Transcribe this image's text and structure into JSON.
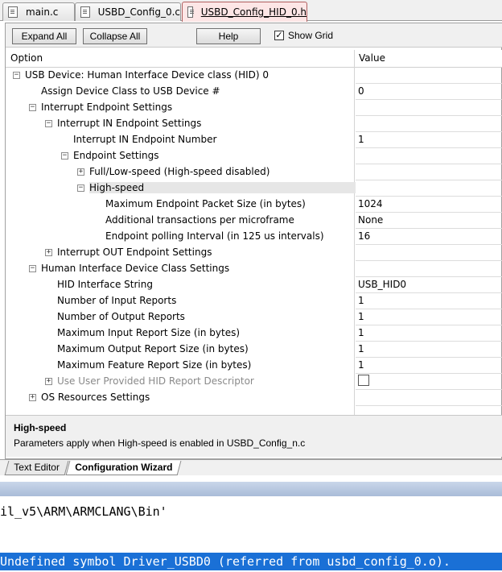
{
  "file_tabs": [
    {
      "label": "main.c",
      "active": false
    },
    {
      "label": "USBD_Config_0.c",
      "active": false
    },
    {
      "label": "USBD_Config_HID_0.h",
      "active": true
    }
  ],
  "toolbar": {
    "expand_all": "Expand All",
    "collapse_all": "Collapse All",
    "help": "Help",
    "show_grid_label": "Show Grid",
    "show_grid_checked": true
  },
  "grid": {
    "col_option": "Option",
    "col_value": "Value",
    "rows": [
      {
        "label": "USB Device: Human Interface Device class (HID) 0",
        "value": "",
        "toggle": "−"
      },
      {
        "label": "Assign Device Class to USB Device #",
        "value": "0",
        "toggle": ""
      },
      {
        "label": "Interrupt Endpoint Settings",
        "value": "",
        "toggle": "−"
      },
      {
        "label": "Interrupt IN Endpoint Settings",
        "value": "",
        "toggle": "−"
      },
      {
        "label": "Interrupt IN Endpoint Number",
        "value": "1",
        "toggle": ""
      },
      {
        "label": "Endpoint Settings",
        "value": "",
        "toggle": "−"
      },
      {
        "label": "Full/Low-speed (High-speed disabled)",
        "value": "",
        "toggle": "+"
      },
      {
        "label": "High-speed",
        "value": "",
        "toggle": "−"
      },
      {
        "label": "Maximum Endpoint Packet Size (in bytes)",
        "value": "1024",
        "toggle": ""
      },
      {
        "label": "Additional transactions per microframe",
        "value": "None",
        "toggle": ""
      },
      {
        "label": "Endpoint polling Interval (in 125 us intervals)",
        "value": "16",
        "toggle": ""
      },
      {
        "label": "Interrupt OUT Endpoint Settings",
        "value": "",
        "toggle": "+"
      },
      {
        "label": "Human Interface Device Class Settings",
        "value": "",
        "toggle": "−"
      },
      {
        "label": "HID Interface String",
        "value": "USB_HID0",
        "toggle": ""
      },
      {
        "label": "Number of Input Reports",
        "value": "1",
        "toggle": ""
      },
      {
        "label": "Number of Output Reports",
        "value": "1",
        "toggle": ""
      },
      {
        "label": "Maximum Input Report Size (in bytes)",
        "value": "1",
        "toggle": ""
      },
      {
        "label": "Maximum Output Report Size (in bytes)",
        "value": "1",
        "toggle": ""
      },
      {
        "label": "Maximum Feature Report Size (in bytes)",
        "value": "1",
        "toggle": ""
      },
      {
        "label": "Use User Provided HID Report Descriptor",
        "value": "",
        "toggle": "+"
      },
      {
        "label": "OS Resources Settings",
        "value": "",
        "toggle": "+"
      }
    ]
  },
  "description": {
    "title": "High-speed",
    "text": "Parameters apply when High-speed is enabled in USBD_Config_n.c"
  },
  "bottom_tabs": {
    "text_editor": "Text Editor",
    "config_wizard": "Configuration Wizard"
  },
  "output": {
    "line1": "il_v5\\ARM\\ARMCLANG\\Bin'",
    "line2": "Undefined symbol Driver_USBD0 (referred from usbd_config_0.o)."
  },
  "colors": {
    "active_tab": "#fde6e6",
    "selection": "#1a70d6"
  }
}
